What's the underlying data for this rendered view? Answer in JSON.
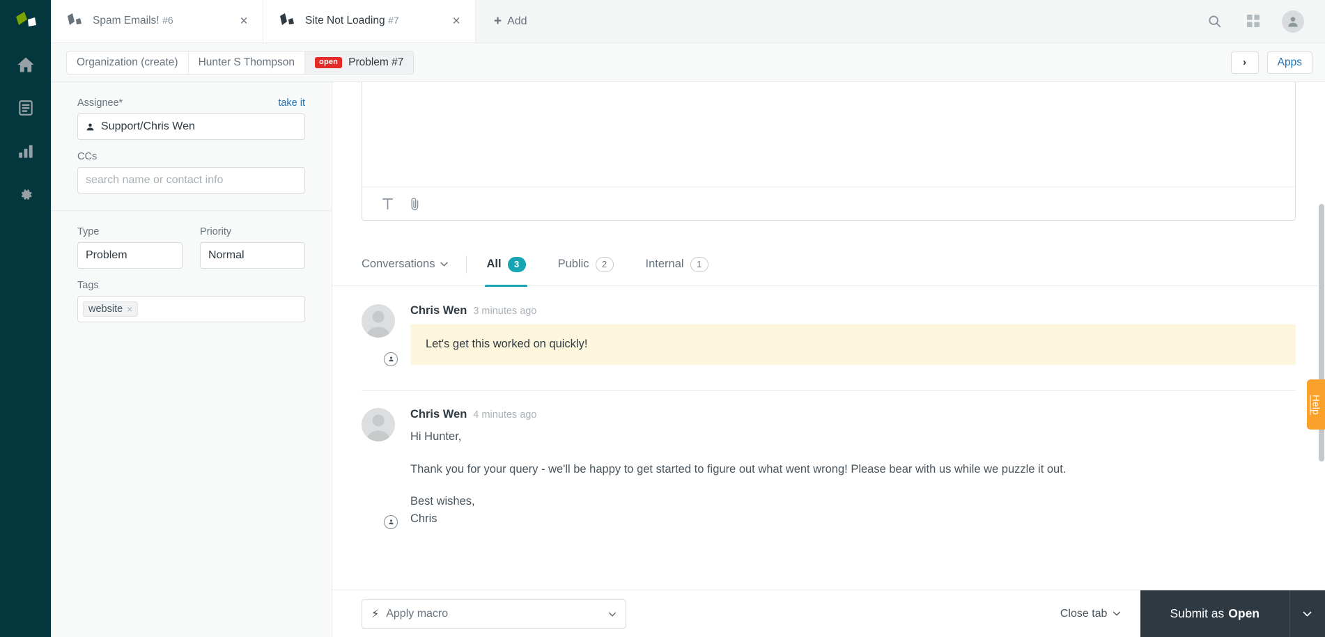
{
  "brand": {
    "accent_teal": "#17a5b4",
    "rail_bg": "#03363d",
    "status_open": "#e32b28",
    "help_orange": "#f9a12b",
    "submit_bg": "#2f3941",
    "internal_note_bg": "#fdf6dd",
    "link_blue": "#1f73b7"
  },
  "rail": {
    "logo_name": "zendesk-logo",
    "items": [
      {
        "name": "home-icon",
        "label": "Home"
      },
      {
        "name": "views-icon",
        "label": "Views"
      },
      {
        "name": "reporting-icon",
        "label": "Reporting"
      },
      {
        "name": "admin-gear-icon",
        "label": "Admin"
      }
    ]
  },
  "tabbar": {
    "tabs": [
      {
        "title": "Spam Emails!",
        "number": "#6",
        "active": false,
        "close_label": "×"
      },
      {
        "title": "Site Not Loading",
        "number": "#7",
        "active": true,
        "close_label": "×"
      }
    ],
    "add_label": "Add",
    "add_plus": "+",
    "actions": [
      {
        "name": "search-icon",
        "label": "Search"
      },
      {
        "name": "apps-grid-icon",
        "label": "Products"
      },
      {
        "name": "user-avatar",
        "label": "Profile"
      }
    ]
  },
  "breadcrumb": {
    "items": [
      {
        "label": "Organization (create)",
        "badge": null
      },
      {
        "label": "Hunter S Thompson",
        "badge": null
      },
      {
        "label": "Problem #7",
        "badge": "open"
      }
    ],
    "next_label": "›",
    "apps_label": "Apps"
  },
  "properties": {
    "assignee": {
      "label": "Assignee*",
      "take_it": "take it",
      "value": "Support/Chris Wen"
    },
    "ccs": {
      "label": "CCs",
      "placeholder": "search name or contact info",
      "value": ""
    },
    "type": {
      "label": "Type",
      "value": "Problem"
    },
    "priority": {
      "label": "Priority",
      "value": "Normal"
    },
    "tags": {
      "label": "Tags",
      "items": [
        {
          "label": "website",
          "remove": "×"
        }
      ]
    }
  },
  "composer": {
    "tools": [
      {
        "name": "text-format-icon",
        "glyph": "T"
      },
      {
        "name": "attachment-paperclip-icon",
        "glyph": "📎"
      }
    ]
  },
  "conversation": {
    "dropdown_label": "Conversations",
    "tabs": [
      {
        "label": "All",
        "count": "3",
        "active": true
      },
      {
        "label": "Public",
        "count": "2",
        "active": false
      },
      {
        "label": "Internal",
        "count": "1",
        "active": false
      }
    ],
    "comments": [
      {
        "author": "Chris Wen",
        "time": "3 minutes ago",
        "type": "internal",
        "body": "Let's get this worked on quickly!"
      },
      {
        "author": "Chris Wen",
        "time": "4 minutes ago",
        "type": "public",
        "greeting": "Hi Hunter,",
        "paragraph": "Thank you for your query - we'll be happy to get started to figure out what went wrong! Please bear with us while we puzzle it out.",
        "signoff": "Best wishes,",
        "signature": "Chris"
      }
    ]
  },
  "footer": {
    "macro_placeholder": "Apply macro",
    "close_tab_label": "Close tab",
    "submit_prefix": "Submit as",
    "submit_state": "Open"
  },
  "help_tab": {
    "label": "Help"
  }
}
